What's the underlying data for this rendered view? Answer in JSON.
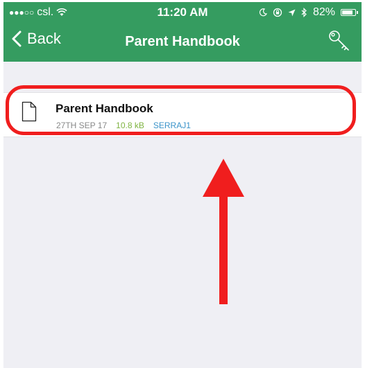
{
  "status_bar": {
    "signal": "●●●○○",
    "carrier": "csl.",
    "time": "11:20 AM",
    "battery_percent": "82%",
    "battery_level": 0.82
  },
  "nav": {
    "back_label": "Back",
    "title": "Parent Handbook"
  },
  "files": [
    {
      "name": "Parent Handbook",
      "date": "27TH SEP 17",
      "size": "10.8 kB",
      "owner": "SERRAJ1"
    }
  ],
  "colors": {
    "header": "#359c60",
    "size_text": "#7fb341",
    "owner_text": "#3a93c9",
    "annotation": "#f01e1e"
  },
  "icons": {
    "back": "chevron-left-icon",
    "key": "key-icon",
    "file": "document-icon"
  }
}
